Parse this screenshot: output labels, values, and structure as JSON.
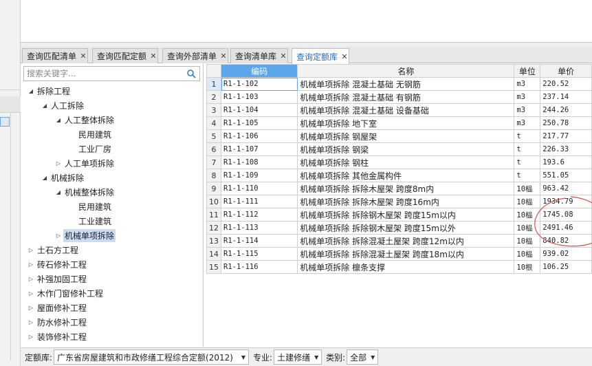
{
  "tabs": [
    {
      "label": "查询匹配清单",
      "active": false
    },
    {
      "label": "查询匹配定额",
      "active": false
    },
    {
      "label": "查询外部清单",
      "active": false
    },
    {
      "label": "查询清单库",
      "active": false
    },
    {
      "label": "查询定额库",
      "active": true
    }
  ],
  "icons": {
    "close": "close-icon",
    "search": "search-icon",
    "expanded": "triangle-expanded-icon",
    "collapsed": "triangle-collapsed-icon",
    "dropdown": "chevron-down-icon"
  },
  "colors": {
    "accent": "#5ba5e8",
    "active_tab_text": "#1f6cc4",
    "selection": "#c9dcf3",
    "annotation": "#d9534f"
  },
  "search": {
    "placeholder": "搜索关键字..."
  },
  "tree": [
    {
      "label": "拆除工程",
      "level": 0,
      "state": "expanded"
    },
    {
      "label": "人工拆除",
      "level": 1,
      "state": "expanded"
    },
    {
      "label": "人工整体拆除",
      "level": 2,
      "state": "expanded"
    },
    {
      "label": "民用建筑",
      "level": 3,
      "state": "leaf"
    },
    {
      "label": "工业厂房",
      "level": 3,
      "state": "leaf"
    },
    {
      "label": "人工单项拆除",
      "level": 2,
      "state": "collapsed"
    },
    {
      "label": "机械拆除",
      "level": 1,
      "state": "expanded"
    },
    {
      "label": "机械整体拆除",
      "level": 2,
      "state": "expanded"
    },
    {
      "label": "民用建筑",
      "level": 3,
      "state": "leaf"
    },
    {
      "label": "工业建筑",
      "level": 3,
      "state": "leaf"
    },
    {
      "label": "机械单项拆除",
      "level": 2,
      "state": "collapsed",
      "selected": true
    },
    {
      "label": "土石方工程",
      "level": 0,
      "state": "collapsed"
    },
    {
      "label": "砖石修补工程",
      "level": 0,
      "state": "collapsed"
    },
    {
      "label": "补强加固工程",
      "level": 0,
      "state": "collapsed"
    },
    {
      "label": "木作门窗修补工程",
      "level": 0,
      "state": "collapsed"
    },
    {
      "label": "屋面修补工程",
      "level": 0,
      "state": "collapsed"
    },
    {
      "label": "防水修补工程",
      "level": 0,
      "state": "collapsed"
    },
    {
      "label": "装饰修补工程",
      "level": 0,
      "state": "collapsed"
    }
  ],
  "grid": {
    "columns": [
      "编码",
      "名称",
      "单位",
      "单价"
    ],
    "rows": [
      {
        "n": "1",
        "code": "R1-1-102",
        "name": "机械单项拆除 混凝土基础 无钢筋",
        "unit": "m3",
        "price": "220.52"
      },
      {
        "n": "2",
        "code": "R1-1-103",
        "name": "机械单项拆除 混凝土基础 有钢筋",
        "unit": "m3",
        "price": "237.14"
      },
      {
        "n": "3",
        "code": "R1-1-104",
        "name": "机械单项拆除 混凝土基础 设备基础",
        "unit": "m3",
        "price": "244.26"
      },
      {
        "n": "4",
        "code": "R1-1-105",
        "name": "机械单项拆除 地下室",
        "unit": "m3",
        "price": "250.78"
      },
      {
        "n": "5",
        "code": "R1-1-106",
        "name": "机械单项拆除 钢屋架",
        "unit": "t",
        "price": "217.77"
      },
      {
        "n": "6",
        "code": "R1-1-107",
        "name": "机械单项拆除 钢梁",
        "unit": "t",
        "price": "226.33"
      },
      {
        "n": "7",
        "code": "R1-1-108",
        "name": "机械单项拆除 钢柱",
        "unit": "t",
        "price": "193.6"
      },
      {
        "n": "8",
        "code": "R1-1-109",
        "name": "机械单项拆除 其他金属构件",
        "unit": "t",
        "price": "551.05"
      },
      {
        "n": "9",
        "code": "R1-1-110",
        "name": "机械单项拆除 拆除木屋架 跨度8m内",
        "unit": "10榀",
        "price": "963.42"
      },
      {
        "n": "10",
        "code": "R1-1-111",
        "name": "机械单项拆除 拆除木屋架 跨度16m内",
        "unit": "10榀",
        "price": "1934.79"
      },
      {
        "n": "11",
        "code": "R1-1-112",
        "name": "机械单项拆除 拆除钢木屋架 跨度15m以内",
        "unit": "10榀",
        "price": "1745.08"
      },
      {
        "n": "12",
        "code": "R1-1-113",
        "name": "机械单项拆除 拆除钢木屋架 跨度15m以外",
        "unit": "10榀",
        "price": "2491.46"
      },
      {
        "n": "13",
        "code": "R1-1-114",
        "name": "机械单项拆除 拆除混凝土屋架 跨度12m以内",
        "unit": "10榀",
        "price": "840.82"
      },
      {
        "n": "14",
        "code": "R1-1-115",
        "name": "机械单项拆除 拆除混凝土屋架 跨度18m以内",
        "unit": "10榀",
        "price": "939.02"
      },
      {
        "n": "15",
        "code": "R1-1-116",
        "name": "机械单项拆除 檩条支撑",
        "unit": "10根",
        "price": "106.25"
      }
    ]
  },
  "bottom": {
    "quota_label": "定额库:",
    "quota_value": "广东省房屋建筑和市政修缮工程综合定额(2012)",
    "major_label": "专业:",
    "major_value": "土建修缮",
    "category_label": "类别:",
    "category_value": "全部"
  }
}
